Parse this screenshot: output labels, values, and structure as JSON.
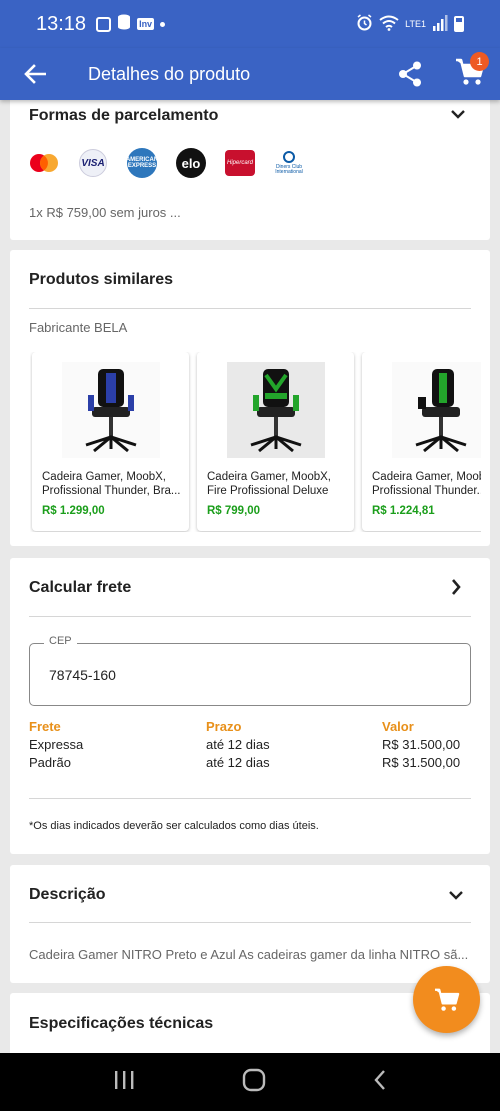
{
  "status_bar": {
    "time": "13:18",
    "network": "LTE1"
  },
  "app_bar": {
    "title": "Detalhes do produto",
    "cart_count": "1"
  },
  "installments": {
    "title": "Formas de parcelamento",
    "card_brands": [
      "mastercard-icon",
      "visa-icon",
      "amex-icon",
      "elo-icon",
      "hipercard-icon",
      "diners-icon"
    ],
    "visa_text": "VISA",
    "elo_text": "elo",
    "amex_text": "AMERICAN EXPRESS",
    "hipercard_text": "Hipercard",
    "diners_text": "Diners Club International",
    "summary": "1x R$ 759,00 sem juros ..."
  },
  "similar": {
    "title": "Produtos similares",
    "manufacturer": "Fabricante  BELA",
    "products": [
      {
        "name": "Cadeira Gamer, MoobX, Profissional Thunder, Bra...",
        "price": "R$ 1.299,00",
        "accent": "#2b3fa8"
      },
      {
        "name": "Cadeira Gamer, MoobX, Fire Profissional Deluxe",
        "price": "R$ 799,00",
        "accent": "#23a52b"
      },
      {
        "name": "Cadeira Gamer, MoobX, Profissional Thunder...",
        "price": "R$ 1.224,81",
        "accent": "#23a52b"
      }
    ]
  },
  "shipping": {
    "title": "Calcular frete",
    "cep_label": "CEP",
    "cep_value": "78745-160",
    "headers": [
      "Frete",
      "Prazo",
      "Valor"
    ],
    "rows": [
      [
        "Expressa",
        "até 12 dias",
        "R$ 31.500,00"
      ],
      [
        "Padrão",
        "até 12 dias",
        "R$ 31.500,00"
      ]
    ],
    "note": "*Os dias indicados deverão ser calculados como dias úteis."
  },
  "description": {
    "title": "Descrição",
    "text": "Cadeira Gamer NITRO Preto e Azul As cadeiras gamer da linha NITRO sã..."
  },
  "specs": {
    "title": "Especificações técnicas"
  },
  "colors": {
    "primary": "#3a63c4",
    "accent_orange": "#f28c1e",
    "price_green": "#1b9e1b",
    "badge": "#ee5a24"
  }
}
